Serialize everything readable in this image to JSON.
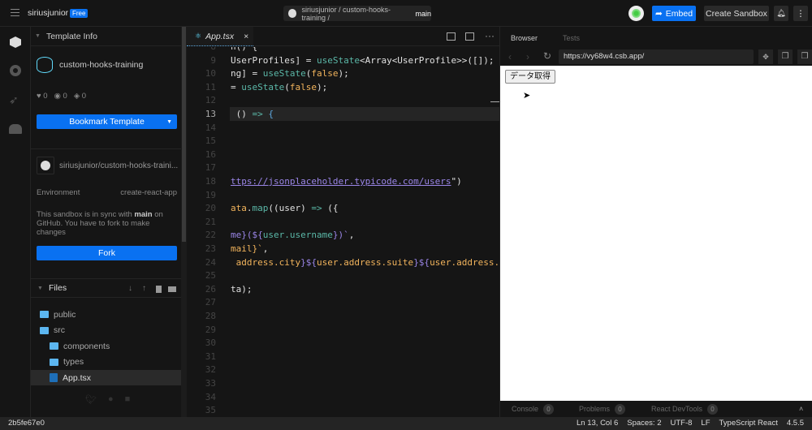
{
  "top": {
    "user": "siriusjunior",
    "plan_badge": "Free",
    "repo_path": "siriusjunior / custom-hooks-training / ",
    "branch": "main",
    "embed": "Embed",
    "create_sandbox": "Create Sandbox"
  },
  "sidebar": {
    "template_info": "Template Info",
    "template_name": "custom-hooks-training",
    "likes": "0",
    "views": "0",
    "forks": "0",
    "bookmark": "Bookmark Template",
    "repo": "siriusjunior/custom-hooks-traini...",
    "env_label": "Environment",
    "env_value": "create-react-app",
    "sync_1": "This sandbox is in sync with ",
    "sync_branch": "main",
    "sync_2": " on GitHub. You have to fork to make changes",
    "fork": "Fork",
    "files": "Files",
    "tree": [
      {
        "name": "public",
        "type": "folder"
      },
      {
        "name": "src",
        "type": "folder-open"
      },
      {
        "name": "components",
        "type": "folder"
      },
      {
        "name": "types",
        "type": "folder"
      },
      {
        "name": "App.tsx",
        "type": "file"
      }
    ]
  },
  "editor": {
    "tab": "App.tsx",
    "lines": [
      {
        "n": "8",
        "t": "n() {"
      },
      {
        "n": "9",
        "h": "<span>UserProfiles] = </span><span class='g'>useState</span><span>&lt;Array&lt;UserProfile&gt;&gt;([]);</span>"
      },
      {
        "n": "10",
        "h": "<span>ng] = </span><span class='g'>useState</span><span>(</span><span class='o'>false</span><span>);</span>"
      },
      {
        "n": "11",
        "h": "<span>= </span><span class='g'>useState</span><span>(</span><span class='o'>false</span><span>);</span>"
      },
      {
        "n": "12",
        "t": ""
      },
      {
        "n": "13",
        "h": "<span> () </span><span class='g'>=&gt;</span><span class='b'> {</span>"
      },
      {
        "n": "14",
        "t": ""
      },
      {
        "n": "15",
        "t": ""
      },
      {
        "n": "16",
        "t": ""
      },
      {
        "n": "17",
        "t": ""
      },
      {
        "n": "18",
        "h": "<span class='p' style='text-decoration:underline'>ttps://jsonplaceholder.typicode.com/users</span><span>\")</span>"
      },
      {
        "n": "19",
        "t": ""
      },
      {
        "n": "20",
        "h": "<span class='o'>ata</span><span>.</span><span class='g'>map</span><span>((user) </span><span class='g'>=&gt;</span><span> ({</span>"
      },
      {
        "n": "21",
        "t": ""
      },
      {
        "n": "22",
        "h": "<span class='p'>me}(${</span><span class='g'>user.username</span><span class='p'>})`</span><span>,</span>"
      },
      {
        "n": "23",
        "h": "<span class='o'>mail}`</span><span>,</span>"
      },
      {
        "n": "24",
        "h": "<span class='o'> address.city</span><span class='p'>}${</span><span class='o'>user.address.suite</span><span class='p'>}${</span><span class='o'>user.address.s</span>"
      },
      {
        "n": "25",
        "t": ""
      },
      {
        "n": "26",
        "t": "ta);"
      },
      {
        "n": "27",
        "t": ""
      },
      {
        "n": "28",
        "t": ""
      },
      {
        "n": "29",
        "t": ""
      },
      {
        "n": "30",
        "t": ""
      },
      {
        "n": "31",
        "t": ""
      },
      {
        "n": "32",
        "t": ""
      },
      {
        "n": "33",
        "t": ""
      },
      {
        "n": "34",
        "t": ""
      },
      {
        "n": "35",
        "t": ""
      }
    ]
  },
  "preview": {
    "tab_browser": "Browser",
    "tab_tests": "Tests",
    "url": "https://vy68w4.csb.app/",
    "button": "データ取得",
    "console": "Console",
    "console_count": "0",
    "problems": "Problems",
    "problems_count": "0",
    "devtools": "React DevTools",
    "devtools_count": "0"
  },
  "status": {
    "hash": "2b5fe67e0",
    "pos": "Ln 13, Col 6",
    "spaces": "Spaces: 2",
    "enc": "UTF-8",
    "eol": "LF",
    "lang": "TypeScript React",
    "ver": "4.5.5"
  },
  "colors": {
    "accent": "#0971f1",
    "folder": "#5cb6f0"
  }
}
